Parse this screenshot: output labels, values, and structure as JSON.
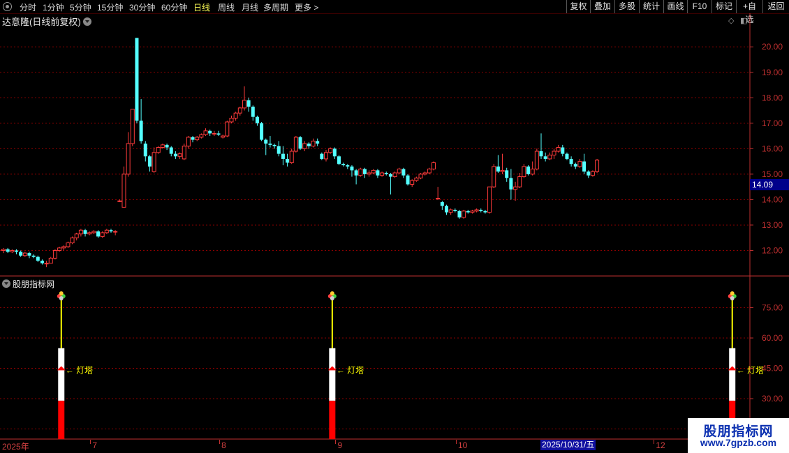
{
  "toolbar": {
    "periods": [
      {
        "label": "分时",
        "active": false
      },
      {
        "label": "1分钟",
        "active": false
      },
      {
        "label": "5分钟",
        "active": false
      },
      {
        "label": "15分钟",
        "active": false
      },
      {
        "label": "30分钟",
        "active": false
      },
      {
        "label": "60分钟",
        "active": false
      },
      {
        "label": "日线",
        "active": true
      },
      {
        "label": "周线",
        "active": false
      },
      {
        "label": "月线",
        "active": false
      },
      {
        "label": "多周期",
        "active": false
      },
      {
        "label": "更多 >",
        "active": false
      }
    ],
    "right_buttons": [
      "复权",
      "叠加",
      "多股",
      "统计",
      "画线",
      "F10",
      "标记",
      "+自选",
      "返回"
    ]
  },
  "chart_title": "达意隆(日线前复权)",
  "current_price_label": "14.09",
  "indicator_title": "股朋指标网",
  "tower_label": "灯塔",
  "date_cursor": "2025/10/31/五",
  "watermark": {
    "title": "股朋指标网",
    "url": "www.7gpzb.com"
  },
  "colors": {
    "up": "#ff3b3b",
    "down": "#54ffff",
    "grid": "#8b0000",
    "axis": "#c03030"
  },
  "chart_data": [
    {
      "type": "candlestick",
      "title": "达意隆(日线前复权)",
      "ylim": [
        11.0,
        20.8
      ],
      "y_ticks": [
        12.0,
        13.0,
        14.0,
        15.0,
        16.0,
        17.0,
        18.0,
        19.0,
        20.0
      ],
      "x_ticks": [
        {
          "label": "2025年",
          "index": 0
        },
        {
          "label": "7",
          "index": 21
        },
        {
          "label": "8",
          "index": 51
        },
        {
          "label": "9",
          "index": 78
        },
        {
          "label": "10",
          "index": 106
        },
        {
          "label": "11",
          "index": 129
        },
        {
          "label": "12",
          "index": 152
        }
      ],
      "candles": [
        [
          12.0,
          12.05,
          11.9,
          12.1
        ],
        [
          12.05,
          11.95,
          11.9,
          12.1
        ],
        [
          11.95,
          12.0,
          11.9,
          12.05
        ],
        [
          12.0,
          11.95,
          11.85,
          12.05
        ],
        [
          11.95,
          11.8,
          11.75,
          12.0
        ],
        [
          11.8,
          11.9,
          11.75,
          11.95
        ],
        [
          11.9,
          11.8,
          11.7,
          11.95
        ],
        [
          11.8,
          11.75,
          11.7,
          11.85
        ],
        [
          11.75,
          11.6,
          11.55,
          11.8
        ],
        [
          11.6,
          11.5,
          11.45,
          11.65
        ],
        [
          11.5,
          11.5,
          11.35,
          11.6
        ],
        [
          11.5,
          11.7,
          11.5,
          11.75
        ],
        [
          11.7,
          12.0,
          11.65,
          12.05
        ],
        [
          12.0,
          12.1,
          11.95,
          12.15
        ],
        [
          12.1,
          12.15,
          12.0,
          12.2
        ],
        [
          12.15,
          12.3,
          12.1,
          12.35
        ],
        [
          12.3,
          12.5,
          12.25,
          12.55
        ],
        [
          12.5,
          12.65,
          12.4,
          12.7
        ],
        [
          12.65,
          12.8,
          12.55,
          12.85
        ],
        [
          12.8,
          12.65,
          12.55,
          12.85
        ],
        [
          12.65,
          12.7,
          12.6,
          12.75
        ],
        [
          12.7,
          12.75,
          12.65,
          12.8
        ],
        [
          12.75,
          12.55,
          12.5,
          12.8
        ],
        [
          12.55,
          12.7,
          12.5,
          12.75
        ],
        [
          12.7,
          12.8,
          12.65,
          12.85
        ],
        [
          12.8,
          12.75,
          12.7,
          12.85
        ],
        [
          12.75,
          12.75,
          12.6,
          12.8
        ],
        [
          13.95,
          13.95,
          13.9,
          14.0
        ],
        [
          13.7,
          15.0,
          13.7,
          15.3
        ],
        [
          15.0,
          16.2,
          14.9,
          16.65
        ],
        [
          16.2,
          17.55,
          16.1,
          17.55
        ],
        [
          20.35,
          17.1,
          17.0,
          20.35
        ],
        [
          17.1,
          16.3,
          16.2,
          17.95
        ],
        [
          16.2,
          15.7,
          15.5,
          16.3
        ],
        [
          15.7,
          15.3,
          15.1,
          15.75
        ],
        [
          15.1,
          15.85,
          15.05,
          16.05
        ],
        [
          15.85,
          16.05,
          15.8,
          16.1
        ],
        [
          16.05,
          16.15,
          16.0,
          16.2
        ],
        [
          16.15,
          16.05,
          15.95,
          16.2
        ],
        [
          16.05,
          15.8,
          15.7,
          16.1
        ],
        [
          15.8,
          15.7,
          15.6,
          15.9
        ],
        [
          15.7,
          15.8,
          15.6,
          15.85
        ],
        [
          15.6,
          16.1,
          15.55,
          16.2
        ],
        [
          16.1,
          16.45,
          16.0,
          16.5
        ],
        [
          16.45,
          16.35,
          16.25,
          16.5
        ],
        [
          16.35,
          16.45,
          16.3,
          16.5
        ],
        [
          16.45,
          16.55,
          16.4,
          16.6
        ],
        [
          16.55,
          16.7,
          16.5,
          16.8
        ],
        [
          16.7,
          16.6,
          16.5,
          16.75
        ],
        [
          16.6,
          16.6,
          16.5,
          16.7
        ],
        [
          16.6,
          16.55,
          16.5,
          16.7
        ],
        [
          16.45,
          16.5,
          16.4,
          16.55
        ],
        [
          16.5,
          17.05,
          16.45,
          17.1
        ],
        [
          17.05,
          17.2,
          17.0,
          17.3
        ],
        [
          17.2,
          17.4,
          17.1,
          17.45
        ],
        [
          17.4,
          17.6,
          17.3,
          17.65
        ],
        [
          17.6,
          17.9,
          17.5,
          18.45
        ],
        [
          17.9,
          17.65,
          17.45,
          18.0
        ],
        [
          17.65,
          17.25,
          17.1,
          17.7
        ],
        [
          17.25,
          17.0,
          16.9,
          17.3
        ],
        [
          17.0,
          16.35,
          16.3,
          17.05
        ],
        [
          16.35,
          16.2,
          15.75,
          16.4
        ],
        [
          16.2,
          16.15,
          16.05,
          16.5
        ],
        [
          16.15,
          16.1,
          16.0,
          16.2
        ],
        [
          16.1,
          15.8,
          15.7,
          16.3
        ],
        [
          15.8,
          15.6,
          15.35,
          16.1
        ],
        [
          15.6,
          15.45,
          15.3,
          15.8
        ],
        [
          15.45,
          15.9,
          15.4,
          16.0
        ],
        [
          15.9,
          16.45,
          15.85,
          16.5
        ],
        [
          16.45,
          16.0,
          15.95,
          16.5
        ],
        [
          16.0,
          16.2,
          15.9,
          16.3
        ],
        [
          16.2,
          16.1,
          16.0,
          16.25
        ],
        [
          16.1,
          16.3,
          16.05,
          16.4
        ],
        [
          16.3,
          16.2,
          16.1,
          16.4
        ],
        [
          15.8,
          15.6,
          15.55,
          15.85
        ],
        [
          15.6,
          15.85,
          15.5,
          15.95
        ],
        [
          15.85,
          16.0,
          15.8,
          16.05
        ],
        [
          16.0,
          15.7,
          15.6,
          16.05
        ],
        [
          15.7,
          15.4,
          15.35,
          15.75
        ],
        [
          15.4,
          15.35,
          15.3,
          15.45
        ],
        [
          15.35,
          15.3,
          15.2,
          15.4
        ],
        [
          15.3,
          15.15,
          14.9,
          15.35
        ],
        [
          15.15,
          14.95,
          14.6,
          15.2
        ],
        [
          14.95,
          15.2,
          14.9,
          15.25
        ],
        [
          15.2,
          15.0,
          14.85,
          15.25
        ],
        [
          15.0,
          15.05,
          14.9,
          15.15
        ],
        [
          15.05,
          15.15,
          15.0,
          15.2
        ],
        [
          15.15,
          14.95,
          14.85,
          15.2
        ],
        [
          14.95,
          15.05,
          14.9,
          15.1
        ],
        [
          15.05,
          15.0,
          14.95,
          15.1
        ],
        [
          15.0,
          14.9,
          14.2,
          15.05
        ],
        [
          14.9,
          15.05,
          14.85,
          15.1
        ],
        [
          15.05,
          15.2,
          15.0,
          15.25
        ],
        [
          15.2,
          14.95,
          14.85,
          15.25
        ],
        [
          14.95,
          14.6,
          14.55,
          15.0
        ],
        [
          14.6,
          14.75,
          14.5,
          14.8
        ],
        [
          14.75,
          14.85,
          14.7,
          14.9
        ],
        [
          14.85,
          15.0,
          14.8,
          15.05
        ],
        [
          15.0,
          15.05,
          14.95,
          15.1
        ],
        [
          15.05,
          15.2,
          15.0,
          15.25
        ],
        [
          15.2,
          15.45,
          15.15,
          15.5
        ],
        [
          14.05,
          14.05,
          14.0,
          14.5
        ],
        [
          13.9,
          13.75,
          13.6,
          13.95
        ],
        [
          13.75,
          13.5,
          13.4,
          13.8
        ],
        [
          13.5,
          13.6,
          13.4,
          13.65
        ],
        [
          13.6,
          13.55,
          13.5,
          13.65
        ],
        [
          13.55,
          13.3,
          13.25,
          13.6
        ],
        [
          13.3,
          13.55,
          13.25,
          13.6
        ],
        [
          13.55,
          13.5,
          13.45,
          13.6
        ],
        [
          13.5,
          13.55,
          13.45,
          13.6
        ],
        [
          13.55,
          13.6,
          13.5,
          13.65
        ],
        [
          13.6,
          13.55,
          13.5,
          13.65
        ],
        [
          13.55,
          13.5,
          13.45,
          13.6
        ],
        [
          13.5,
          14.5,
          13.45,
          14.5
        ],
        [
          14.5,
          15.3,
          14.45,
          15.4
        ],
        [
          15.3,
          15.1,
          15.05,
          15.75
        ],
        [
          15.1,
          15.15,
          15.0,
          15.8
        ],
        [
          15.15,
          14.85,
          14.7,
          15.25
        ],
        [
          14.85,
          14.4,
          14.0,
          15.2
        ],
        [
          14.4,
          14.5,
          13.95,
          14.7
        ],
        [
          14.5,
          14.9,
          14.45,
          15.05
        ],
        [
          14.9,
          15.3,
          14.85,
          15.4
        ],
        [
          15.3,
          15.0,
          14.95,
          15.35
        ],
        [
          15.0,
          15.2,
          14.95,
          15.5
        ],
        [
          15.2,
          15.9,
          15.15,
          16.0
        ],
        [
          15.9,
          15.7,
          15.6,
          16.6
        ],
        [
          15.7,
          15.6,
          15.5,
          15.85
        ],
        [
          15.6,
          15.75,
          15.55,
          15.85
        ],
        [
          15.75,
          15.9,
          15.6,
          16.0
        ],
        [
          15.9,
          16.05,
          15.85,
          16.15
        ],
        [
          16.05,
          15.8,
          15.7,
          16.15
        ],
        [
          15.8,
          15.6,
          15.55,
          15.85
        ],
        [
          15.6,
          15.4,
          15.3,
          15.7
        ],
        [
          15.4,
          15.3,
          15.2,
          15.45
        ],
        [
          15.3,
          15.5,
          15.25,
          15.6
        ],
        [
          15.5,
          15.1,
          15.0,
          15.8
        ],
        [
          15.1,
          14.95,
          14.85,
          15.15
        ],
        [
          14.95,
          15.1,
          14.9,
          15.15
        ],
        [
          15.1,
          15.55,
          15.05,
          15.6
        ]
      ],
      "current_price": 14.09
    },
    {
      "type": "bar",
      "title": "股朋指标网",
      "ylim": [
        10,
        90
      ],
      "y_ticks": [
        15.0,
        30.0,
        45.0,
        60.0,
        75.0
      ],
      "towers": [
        {
          "candle_index": 11,
          "red_top": 29,
          "white_top": 55,
          "top": 80,
          "cap_at": 44,
          "label": "灯塔"
        },
        {
          "candle_index": 74,
          "red_top": 29,
          "white_top": 55,
          "top": 80,
          "cap_at": 44,
          "label": "灯塔"
        },
        {
          "candle_index": 167,
          "red_top": 29,
          "white_top": 55,
          "top": 80,
          "cap_at": 44,
          "label": "灯塔"
        }
      ]
    }
  ]
}
